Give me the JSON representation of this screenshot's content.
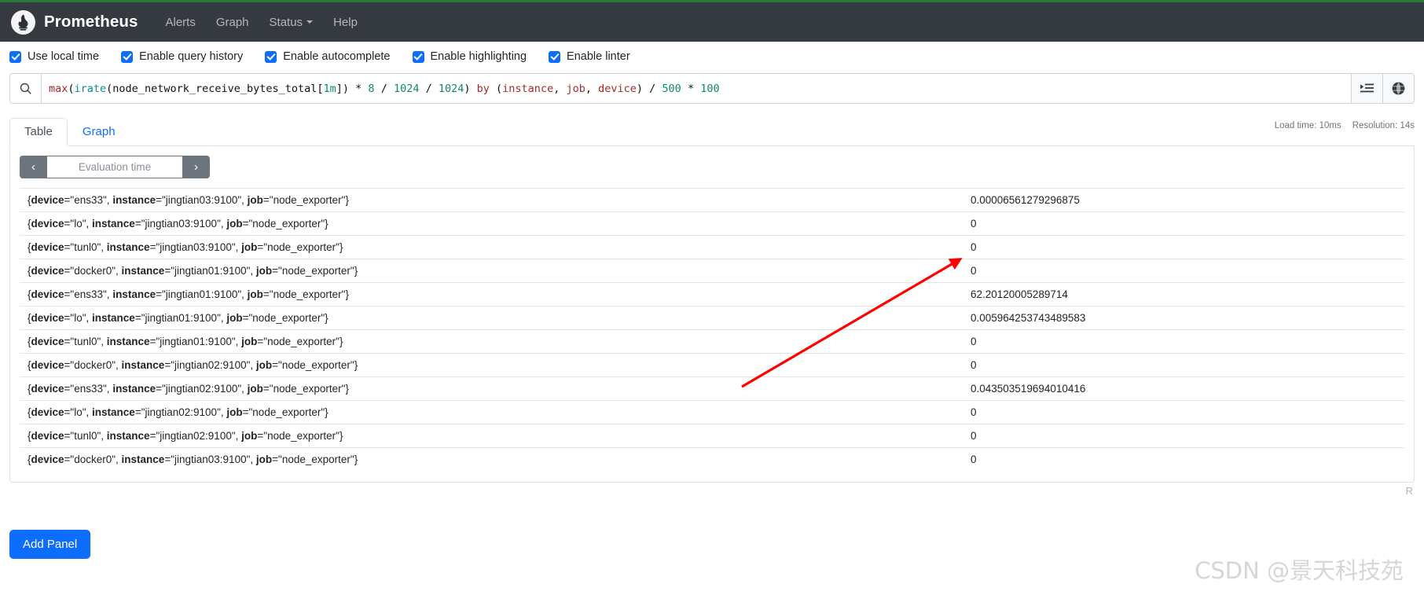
{
  "navbar": {
    "brand": "Prometheus",
    "logo_icon": "prometheus-torch-logo",
    "links": [
      {
        "label": "Alerts",
        "has_caret": false
      },
      {
        "label": "Graph",
        "has_caret": false
      },
      {
        "label": "Status",
        "has_caret": true
      },
      {
        "label": "Help",
        "has_caret": false
      }
    ]
  },
  "options": [
    {
      "label": "Use local time",
      "checked": true
    },
    {
      "label": "Enable query history",
      "checked": true
    },
    {
      "label": "Enable autocomplete",
      "checked": true
    },
    {
      "label": "Enable highlighting",
      "checked": true
    },
    {
      "label": "Enable linter",
      "checked": true
    }
  ],
  "query": {
    "search_icon": "search-icon",
    "expression": "max(irate(node_network_receive_bytes_total[1m]) * 8 / 1024 / 1024) by (instance, job, device) / 500 * 100",
    "tokens": [
      {
        "t": "max",
        "c": "tok-fn"
      },
      {
        "t": "(",
        "c": "tok-plain"
      },
      {
        "t": "irate",
        "c": "tok-fn2"
      },
      {
        "t": "(node_network_receive_bytes_total[",
        "c": "tok-plain"
      },
      {
        "t": "1m",
        "c": "tok-dur"
      },
      {
        "t": "]) * ",
        "c": "tok-plain"
      },
      {
        "t": "8",
        "c": "tok-num"
      },
      {
        "t": " / ",
        "c": "tok-plain"
      },
      {
        "t": "1024",
        "c": "tok-num"
      },
      {
        "t": " / ",
        "c": "tok-plain"
      },
      {
        "t": "1024",
        "c": "tok-num"
      },
      {
        "t": ") ",
        "c": "tok-plain"
      },
      {
        "t": "by",
        "c": "tok-kw"
      },
      {
        "t": " (",
        "c": "tok-plain"
      },
      {
        "t": "instance",
        "c": "tok-lbl"
      },
      {
        "t": ", ",
        "c": "tok-plain"
      },
      {
        "t": "job",
        "c": "tok-lbl"
      },
      {
        "t": ", ",
        "c": "tok-plain"
      },
      {
        "t": "device",
        "c": "tok-lbl"
      },
      {
        "t": ") / ",
        "c": "tok-plain"
      },
      {
        "t": "500",
        "c": "tok-num"
      },
      {
        "t": " * ",
        "c": "tok-plain"
      },
      {
        "t": "100",
        "c": "tok-num"
      }
    ],
    "buttons": [
      {
        "icon": "metrics-explorer-icon",
        "title": "Open metrics explorer"
      },
      {
        "icon": "globe-icon",
        "title": "Open query page"
      }
    ]
  },
  "tabs": [
    {
      "label": "Table",
      "active": true
    },
    {
      "label": "Graph",
      "active": false
    }
  ],
  "meta": {
    "load_time": "Load time: 10ms",
    "resolution": "Resolution: 14s"
  },
  "evaluation_time": {
    "prev_icon": "chevron-left-icon",
    "next_icon": "chevron-right-icon",
    "placeholder": "Evaluation time",
    "value": ""
  },
  "table": {
    "rows": [
      {
        "labels": [
          [
            "device",
            "ens33"
          ],
          [
            "instance",
            "jingtian03:9100"
          ],
          [
            "job",
            "node_exporter"
          ]
        ],
        "value": "0.00006561279296875"
      },
      {
        "labels": [
          [
            "device",
            "lo"
          ],
          [
            "instance",
            "jingtian03:9100"
          ],
          [
            "job",
            "node_exporter"
          ]
        ],
        "value": "0"
      },
      {
        "labels": [
          [
            "device",
            "tunl0"
          ],
          [
            "instance",
            "jingtian03:9100"
          ],
          [
            "job",
            "node_exporter"
          ]
        ],
        "value": "0"
      },
      {
        "labels": [
          [
            "device",
            "docker0"
          ],
          [
            "instance",
            "jingtian01:9100"
          ],
          [
            "job",
            "node_exporter"
          ]
        ],
        "value": "0"
      },
      {
        "labels": [
          [
            "device",
            "ens33"
          ],
          [
            "instance",
            "jingtian01:9100"
          ],
          [
            "job",
            "node_exporter"
          ]
        ],
        "value": "62.20120005289714"
      },
      {
        "labels": [
          [
            "device",
            "lo"
          ],
          [
            "instance",
            "jingtian01:9100"
          ],
          [
            "job",
            "node_exporter"
          ]
        ],
        "value": "0.005964253743489583"
      },
      {
        "labels": [
          [
            "device",
            "tunl0"
          ],
          [
            "instance",
            "jingtian01:9100"
          ],
          [
            "job",
            "node_exporter"
          ]
        ],
        "value": "0"
      },
      {
        "labels": [
          [
            "device",
            "docker0"
          ],
          [
            "instance",
            "jingtian02:9100"
          ],
          [
            "job",
            "node_exporter"
          ]
        ],
        "value": "0"
      },
      {
        "labels": [
          [
            "device",
            "ens33"
          ],
          [
            "instance",
            "jingtian02:9100"
          ],
          [
            "job",
            "node_exporter"
          ]
        ],
        "value": "0.043503519694010416"
      },
      {
        "labels": [
          [
            "device",
            "lo"
          ],
          [
            "instance",
            "jingtian02:9100"
          ],
          [
            "job",
            "node_exporter"
          ]
        ],
        "value": "0"
      },
      {
        "labels": [
          [
            "device",
            "tunl0"
          ],
          [
            "instance",
            "jingtian02:9100"
          ],
          [
            "job",
            "node_exporter"
          ]
        ],
        "value": "0"
      },
      {
        "labels": [
          [
            "device",
            "docker0"
          ],
          [
            "instance",
            "jingtian03:9100"
          ],
          [
            "job",
            "node_exporter"
          ]
        ],
        "value": "0"
      }
    ]
  },
  "footer": {
    "add_panel_label": "Add Panel",
    "remove_panel_label": "R"
  },
  "annotation": {
    "arrow_color": "#ff0000",
    "points_to_value": "62.20120005289714"
  },
  "watermark": "CSDN @景天科技苑",
  "colors": {
    "navbar_bg": "#343a40",
    "navbar_top_accent": "#2a7a3c",
    "accent_blue": "#0d6efd",
    "muted_gray": "#6c757d",
    "border": "#dee2e6"
  }
}
